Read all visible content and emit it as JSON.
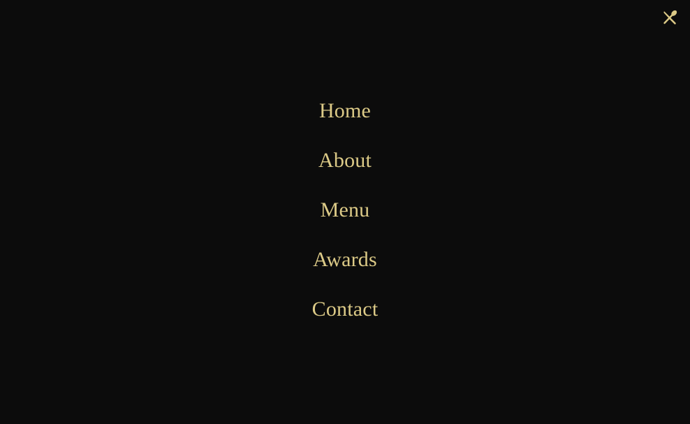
{
  "colors": {
    "background": "#0c0c0c",
    "accent": "#dcca87"
  },
  "close_button": {
    "icon": "close-icon"
  },
  "nav": {
    "items": [
      {
        "label": "Home"
      },
      {
        "label": "About"
      },
      {
        "label": "Menu"
      },
      {
        "label": "Awards"
      },
      {
        "label": "Contact"
      }
    ]
  }
}
